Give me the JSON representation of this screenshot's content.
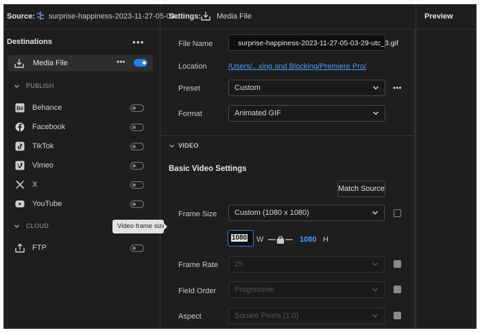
{
  "source": {
    "label": "Source:",
    "filename": "surprise-happiness-2023-11-27-05-03..."
  },
  "destinations": {
    "title": "Destinations",
    "media_file": {
      "label": "Media File",
      "enabled": true
    },
    "publish_header": "PUBLISH",
    "publish_items": [
      {
        "label": "Behance",
        "icon": "behance-icon"
      },
      {
        "label": "Facebook",
        "icon": "facebook-icon"
      },
      {
        "label": "TikTok",
        "icon": "tiktok-icon"
      },
      {
        "label": "Vimeo",
        "icon": "vimeo-icon"
      },
      {
        "label": "X",
        "icon": "x-icon"
      },
      {
        "label": "YouTube",
        "icon": "youtube-icon"
      }
    ],
    "cloud_header": "CLOUD",
    "cloud_items": [
      {
        "label": "FTP",
        "icon": "upload-icon"
      }
    ]
  },
  "tooltip": "Video frame size",
  "settings": {
    "label": "Settings:",
    "target": "Media File",
    "file_name_label": "File Name",
    "file_name_value": "surprise-happiness-2023-11-27-05-03-29-utc_3.gif",
    "location_label": "Location",
    "location_value": "/Users/...xing and Blocking/Premiere Pro/",
    "preset_label": "Preset",
    "preset_value": "Custom",
    "format_label": "Format",
    "format_value": "Animated GIF"
  },
  "video": {
    "section_label": "VIDEO",
    "basic_heading": "Basic Video Settings",
    "match_source": "Match Source",
    "frame_size_label": "Frame Size",
    "frame_size_value": "Custom (1080 x 1080)",
    "width_value": "1080",
    "width_label": "W",
    "height_value": "1080",
    "height_label": "H",
    "frame_rate_label": "Frame Rate",
    "frame_rate_value": "25",
    "field_order_label": "Field Order",
    "field_order_value": "Progressive",
    "aspect_label": "Aspect",
    "aspect_value": "Square Pixels (1.0)"
  },
  "preview": {
    "title": "Preview"
  },
  "colors": {
    "accent": "#2680eb",
    "link": "#4a9df8",
    "background": "#1e1e1e"
  }
}
